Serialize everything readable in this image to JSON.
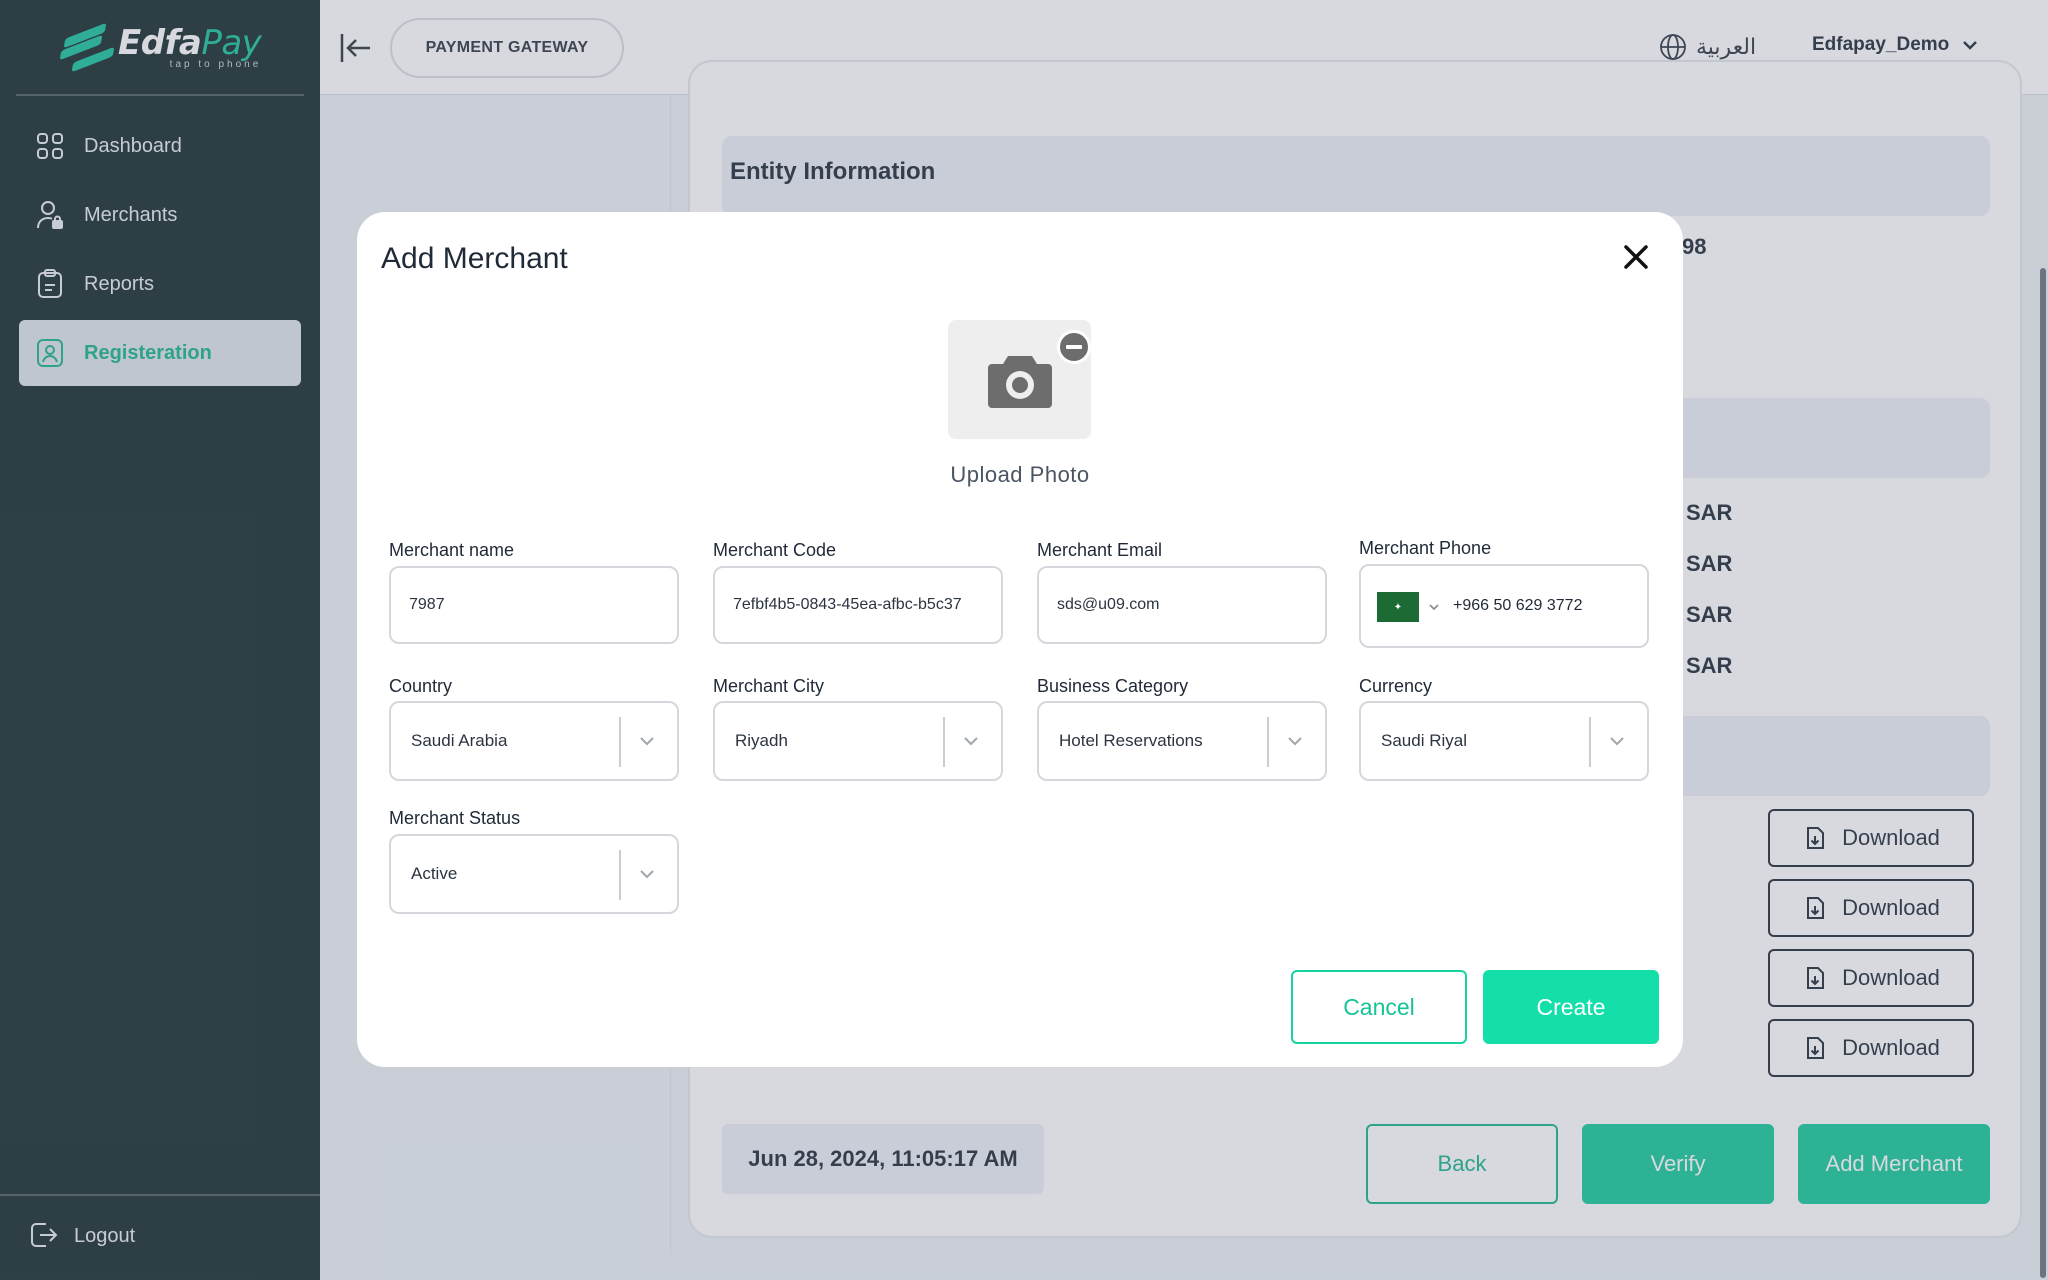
{
  "brand": {
    "name_main": "Edfa",
    "name_accent": "Pay",
    "tagline": "tap to phone",
    "accent_color": "#17c39b"
  },
  "sidebar": {
    "items": [
      {
        "label": "Dashboard",
        "icon": "grid-icon"
      },
      {
        "label": "Merchants",
        "icon": "user-lock-icon"
      },
      {
        "label": "Reports",
        "icon": "clipboard-icon"
      },
      {
        "label": "Registeration",
        "icon": "id-badge-icon",
        "active": true
      }
    ],
    "logout_label": "Logout"
  },
  "topbar": {
    "gateway_label": "PAYMENT GATEWAY",
    "language_label": "العربية",
    "user_name": "Edfapay_Demo"
  },
  "background": {
    "entity_title": "Entity Information",
    "partial_value": "98",
    "sar_values": [
      "SAR",
      "SAR",
      "SAR",
      "SAR"
    ],
    "download_label": "Download",
    "timestamp": "Jun 28, 2024, 11:05:17 AM",
    "back_label": "Back",
    "verify_label": "Verify",
    "add_merchant_label": "Add Merchant"
  },
  "modal": {
    "title": "Add Merchant",
    "upload_label": "Upload Photo",
    "fields": {
      "merchant_name": {
        "label": "Merchant name",
        "value": "7987"
      },
      "merchant_code": {
        "label": "Merchant Code",
        "value": "7efbf4b5-0843-45ea-afbc-b5c37"
      },
      "merchant_email": {
        "label": "Merchant Email",
        "value": "sds@u09.com"
      },
      "merchant_phone": {
        "label": "Merchant Phone",
        "value": "+966 50 629 3772",
        "flag": "saudi-flag-icon"
      },
      "country": {
        "label": "Country",
        "value": "Saudi Arabia"
      },
      "merchant_city": {
        "label": "Merchant City",
        "value": "Riyadh"
      },
      "business_category": {
        "label": "Business Category",
        "value": "Hotel Reservations"
      },
      "currency": {
        "label": "Currency",
        "value": "Saudi Riyal"
      },
      "merchant_status": {
        "label": "Merchant Status",
        "value": "Active"
      }
    },
    "cancel_label": "Cancel",
    "create_label": "Create",
    "primary_color": "#14dfa9"
  }
}
